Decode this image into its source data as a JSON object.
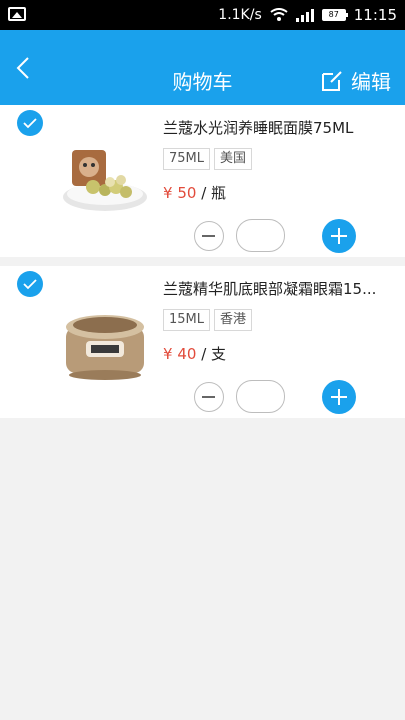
{
  "status_bar": {
    "speed": "1.1K/s",
    "battery": "87",
    "time": "11:15"
  },
  "header": {
    "title": "购物车",
    "edit_label": "编辑"
  },
  "items": [
    {
      "name": "兰蔻水光润养睡眠面膜75ML",
      "tags": [
        "75ML",
        "美国"
      ],
      "currency": "¥",
      "price": "50",
      "unit": "/ 瓶",
      "quantity": "",
      "checked": true
    },
    {
      "name": "兰蔻精华肌底眼部凝霜眼霜15...",
      "tags": [
        "15ML",
        "香港"
      ],
      "currency": "¥",
      "price": "40",
      "unit": "/ 支",
      "quantity": "",
      "checked": true
    }
  ],
  "colors": {
    "primary": "#1aa1ec",
    "price": "#e24b3b",
    "background": "#f2f2f2"
  }
}
